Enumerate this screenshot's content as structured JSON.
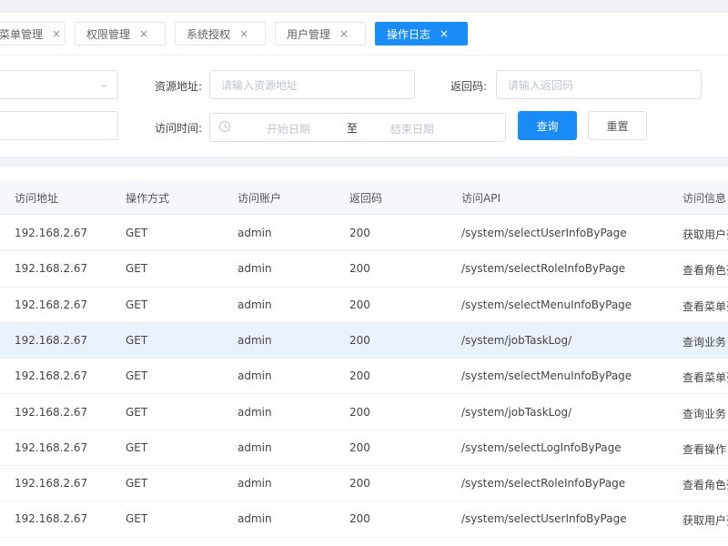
{
  "tabs": [
    {
      "label": "菜单管理",
      "active": false
    },
    {
      "label": "权限管理",
      "active": false
    },
    {
      "label": "系统授权",
      "active": false
    },
    {
      "label": "用户管理",
      "active": false
    },
    {
      "label": "操作日志",
      "active": true
    }
  ],
  "tab_close_glyph": "×",
  "filter": {
    "select_chevron": "⌄",
    "resource_label": "资源地址:",
    "resource_placeholder": "请输入资源地址",
    "code_label": "返回码:",
    "code_placeholder": "请输入返回码",
    "time_label": "访问时间:",
    "start_placeholder": "开始日期",
    "range_sep": "至",
    "end_placeholder": "结束日期",
    "query_button": "查询",
    "reset_button": "重置"
  },
  "table": {
    "columns": [
      "访问地址",
      "操作方式",
      "访问账户",
      "返回码",
      "访问API",
      "访问信息"
    ],
    "rows": [
      {
        "ip": "192.168.2.67",
        "method": "GET",
        "user": "admin",
        "code": "200",
        "api": "/system/selectUserInfoByPage",
        "info": "获取用户列表"
      },
      {
        "ip": "192.168.2.67",
        "method": "GET",
        "user": "admin",
        "code": "200",
        "api": "/system/selectRoleInfoByPage",
        "info": "查看角色列表"
      },
      {
        "ip": "192.168.2.67",
        "method": "GET",
        "user": "admin",
        "code": "200",
        "api": "/system/selectMenuInfoByPage",
        "info": "查看菜单列表"
      },
      {
        "ip": "192.168.2.67",
        "method": "GET",
        "user": "admin",
        "code": "200",
        "api": "/system/jobTaskLog/",
        "info": "查询业务日志"
      },
      {
        "ip": "192.168.2.67",
        "method": "GET",
        "user": "admin",
        "code": "200",
        "api": "/system/selectMenuInfoByPage",
        "info": "查看菜单列表"
      },
      {
        "ip": "192.168.2.67",
        "method": "GET",
        "user": "admin",
        "code": "200",
        "api": "/system/jobTaskLog/",
        "info": "查询业务日志"
      },
      {
        "ip": "192.168.2.67",
        "method": "GET",
        "user": "admin",
        "code": "200",
        "api": "/system/selectLogInfoByPage",
        "info": "查看操作日志"
      },
      {
        "ip": "192.168.2.67",
        "method": "GET",
        "user": "admin",
        "code": "200",
        "api": "/system/selectRoleInfoByPage",
        "info": "查看角色列表"
      },
      {
        "ip": "192.168.2.67",
        "method": "GET",
        "user": "admin",
        "code": "200",
        "api": "/system/selectUserInfoByPage",
        "info": "获取用户列表"
      }
    ],
    "highlighted_row": 3
  },
  "colors": {
    "accent": "#1a8cf8",
    "page_bg": "#f0f2f5",
    "row_highlight": "#eaf3fd"
  }
}
